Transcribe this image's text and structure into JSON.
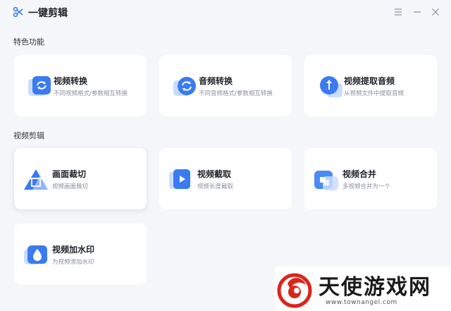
{
  "app": {
    "title": "一键剪辑",
    "icon": "scissors-icon",
    "accent": "#3a7bf0"
  },
  "window_controls": [
    "menu-icon",
    "minimize-icon",
    "close-icon"
  ],
  "sections": [
    {
      "title": "特色功能",
      "cards": [
        {
          "title": "视频转换",
          "desc": "不同视频格式/参数相互转换",
          "icon": "video-convert-icon"
        },
        {
          "title": "音频转换",
          "desc": "不同音频格式/参数相互转换",
          "icon": "audio-convert-icon"
        },
        {
          "title": "视频提取音频",
          "desc": "从视频文件中提取音频",
          "icon": "extract-audio-icon"
        }
      ]
    },
    {
      "title": "视频剪辑",
      "cards": [
        {
          "title": "画面裁切",
          "desc": "视频画面裁切",
          "icon": "crop-icon"
        },
        {
          "title": "视频截取",
          "desc": "视频长度截取",
          "icon": "trim-icon"
        },
        {
          "title": "视频合并",
          "desc": "多视频合并为一个",
          "icon": "merge-icon"
        },
        {
          "title": "视频加水印",
          "desc": "为视频添加水印",
          "icon": "watermark-icon"
        }
      ]
    }
  ],
  "watermark": {
    "text": "天使游戏网",
    "url": "www.townangel.com"
  }
}
